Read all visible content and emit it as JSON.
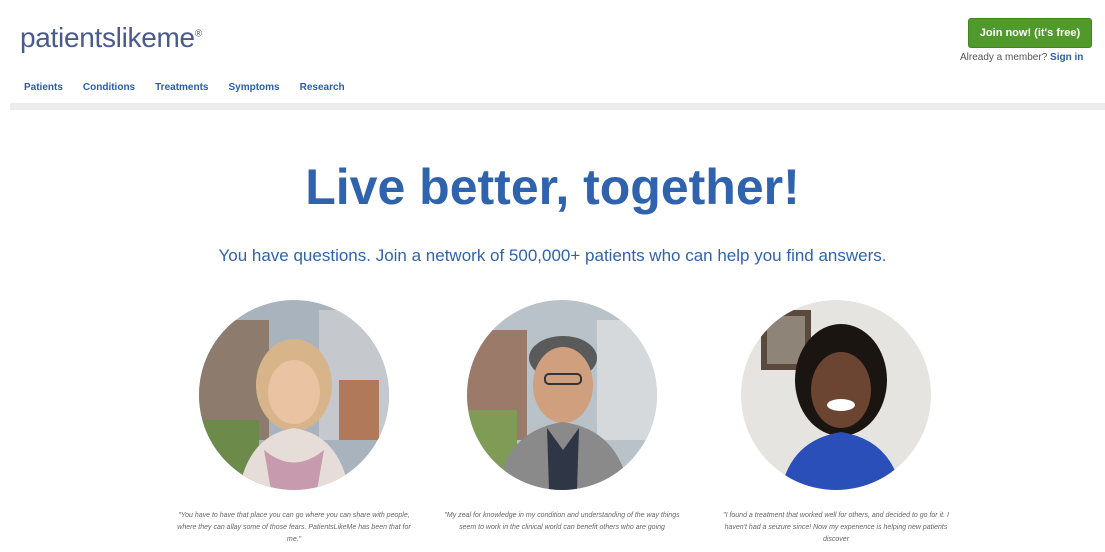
{
  "header": {
    "logo": {
      "part1": "patients",
      "part2": "likeme",
      "mark": "®"
    },
    "join_button": "Join now! (it's free)",
    "member_prompt": "Already a member?",
    "sign_in": "Sign in"
  },
  "nav": {
    "items": [
      {
        "label": "Patients"
      },
      {
        "label": "Conditions"
      },
      {
        "label": "Treatments"
      },
      {
        "label": "Symptoms"
      },
      {
        "label": "Research"
      }
    ]
  },
  "hero": {
    "title": "Live better, together!",
    "subtitle": "You have questions. Join a network of 500,000+ patients who can help you find answers."
  },
  "testimonials": [
    {
      "quote": "\"You have to have that place you can go where you can share with people, where they can allay some of those fears. PatientsLikeMe has been that for me.\""
    },
    {
      "quote": "\"My zeal for knowledge in my condition and understanding of the way things seem to work in the clinical world can benefit others who are going"
    },
    {
      "quote": "\"I found a treatment that worked well for others, and decided to go for it. I haven't had a seizure since! Now my experience is helping new patients discover"
    }
  ],
  "colors": {
    "brand_blue": "#2f63ad",
    "join_green": "#4f9a2b",
    "nav_blue": "#2a5db0"
  }
}
